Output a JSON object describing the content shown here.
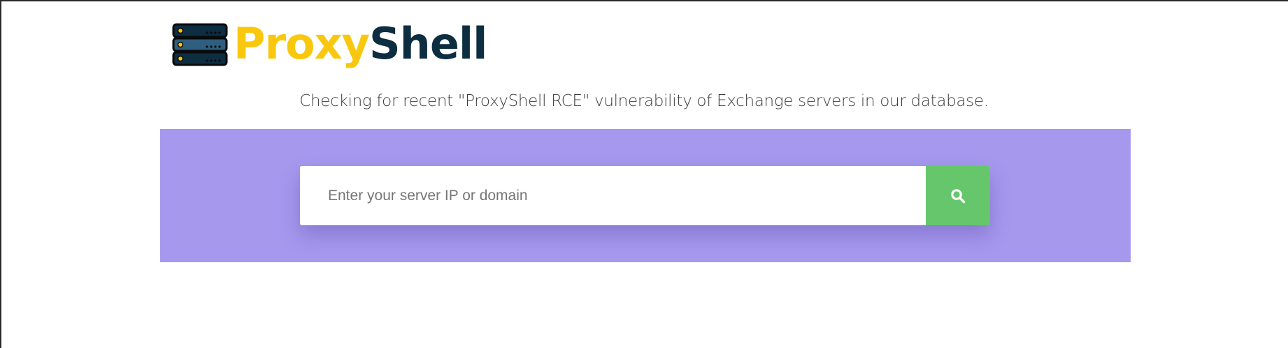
{
  "logo": {
    "word_part_1": "Proxy",
    "word_part_2": "Shell",
    "icon": "server-rack-icon"
  },
  "subtitle": "Checking for recent \"ProxyShell RCE\" vulnerability of Exchange servers in our database.",
  "search": {
    "placeholder": "Enter your server IP or domain",
    "value": "",
    "button_icon": "search-icon"
  },
  "colors": {
    "brand_yellow": "#f9c80e",
    "brand_navy": "#0d2d40",
    "band_purple": "#a598ed",
    "button_green": "#65c66c"
  }
}
